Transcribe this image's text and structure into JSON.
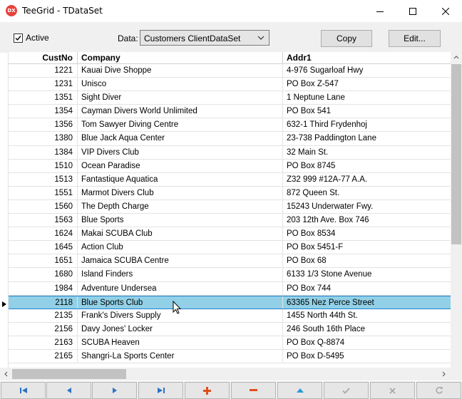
{
  "window": {
    "title": "TeeGrid - TDataSet",
    "app_icon_text": "DX"
  },
  "toolbar": {
    "active_label": "Active",
    "active_checked": true,
    "data_label": "Data:",
    "data_value": "Customers ClientDataSet",
    "copy_label": "Copy",
    "edit_label": "Edit..."
  },
  "grid": {
    "columns": [
      "CustNo",
      "Company",
      "Addr1"
    ],
    "selected_custno": "2118",
    "rows": [
      {
        "custno": "1221",
        "company": "Kauai Dive Shoppe",
        "addr1": "4-976 Sugarloaf Hwy"
      },
      {
        "custno": "1231",
        "company": "Unisco",
        "addr1": "PO Box Z-547"
      },
      {
        "custno": "1351",
        "company": "Sight Diver",
        "addr1": "1 Neptune Lane"
      },
      {
        "custno": "1354",
        "company": "Cayman Divers World Unlimited",
        "addr1": "PO Box 541"
      },
      {
        "custno": "1356",
        "company": "Tom Sawyer Diving Centre",
        "addr1": "632-1 Third Frydenhoj"
      },
      {
        "custno": "1380",
        "company": "Blue Jack Aqua Center",
        "addr1": "23-738 Paddington Lane"
      },
      {
        "custno": "1384",
        "company": "VIP Divers Club",
        "addr1": "32 Main St."
      },
      {
        "custno": "1510",
        "company": "Ocean Paradise",
        "addr1": "PO Box 8745"
      },
      {
        "custno": "1513",
        "company": "Fantastique Aquatica",
        "addr1": "Z32 999 #12A-77 A.A."
      },
      {
        "custno": "1551",
        "company": "Marmot Divers Club",
        "addr1": "872 Queen St."
      },
      {
        "custno": "1560",
        "company": "The Depth Charge",
        "addr1": "15243 Underwater Fwy."
      },
      {
        "custno": "1563",
        "company": "Blue Sports",
        "addr1": "203 12th Ave. Box 746"
      },
      {
        "custno": "1624",
        "company": "Makai SCUBA Club",
        "addr1": "PO Box 8534"
      },
      {
        "custno": "1645",
        "company": "Action Club",
        "addr1": "PO Box 5451-F"
      },
      {
        "custno": "1651",
        "company": "Jamaica SCUBA Centre",
        "addr1": "PO Box 68"
      },
      {
        "custno": "1680",
        "company": "Island Finders",
        "addr1": "6133 1/3 Stone Avenue"
      },
      {
        "custno": "1984",
        "company": "Adventure Undersea",
        "addr1": "PO Box 744"
      },
      {
        "custno": "2118",
        "company": "Blue Sports Club",
        "addr1": "63365 Nez Perce Street"
      },
      {
        "custno": "2135",
        "company": "Frank's Divers Supply",
        "addr1": "1455 North 44th St."
      },
      {
        "custno": "2156",
        "company": "Davy Jones' Locker",
        "addr1": "246 South 16th Place"
      },
      {
        "custno": "2163",
        "company": "SCUBA Heaven",
        "addr1": "PO Box Q-8874"
      },
      {
        "custno": "2165",
        "company": "Shangri-La Sports Center",
        "addr1": "PO Box D-5495"
      }
    ]
  },
  "navigator": {
    "buttons": [
      "first-icon",
      "prior-icon",
      "next-icon",
      "last-icon",
      "insert-icon",
      "delete-icon",
      "edit-icon",
      "post-icon",
      "cancel-icon",
      "refresh-icon"
    ]
  },
  "colors": {
    "selected_row": "#91d0e6",
    "selected_border": "#1e7fd0",
    "nav_blue": "#2a73c8",
    "nav_red": "#e04e1b"
  }
}
